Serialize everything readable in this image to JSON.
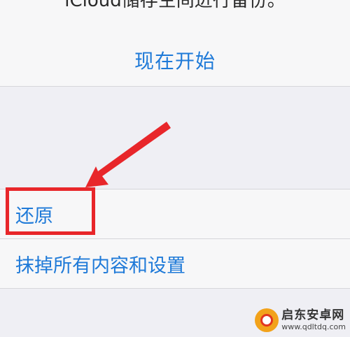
{
  "top_section": {
    "backup_note": "iCloud储存空间进行备份。",
    "start_now_label": "现在开始"
  },
  "reset_list": {
    "items": [
      {
        "label": "还原"
      },
      {
        "label": "抹掉所有内容和设置"
      }
    ]
  },
  "annotation": {
    "color": "#e8262a"
  },
  "watermark": {
    "name": "启东安卓网",
    "url": "www.qdltdq.com"
  },
  "colors": {
    "link_blue": "#1f7ad8",
    "background": "#efeff4",
    "cell_background": "#f7f7f8"
  }
}
